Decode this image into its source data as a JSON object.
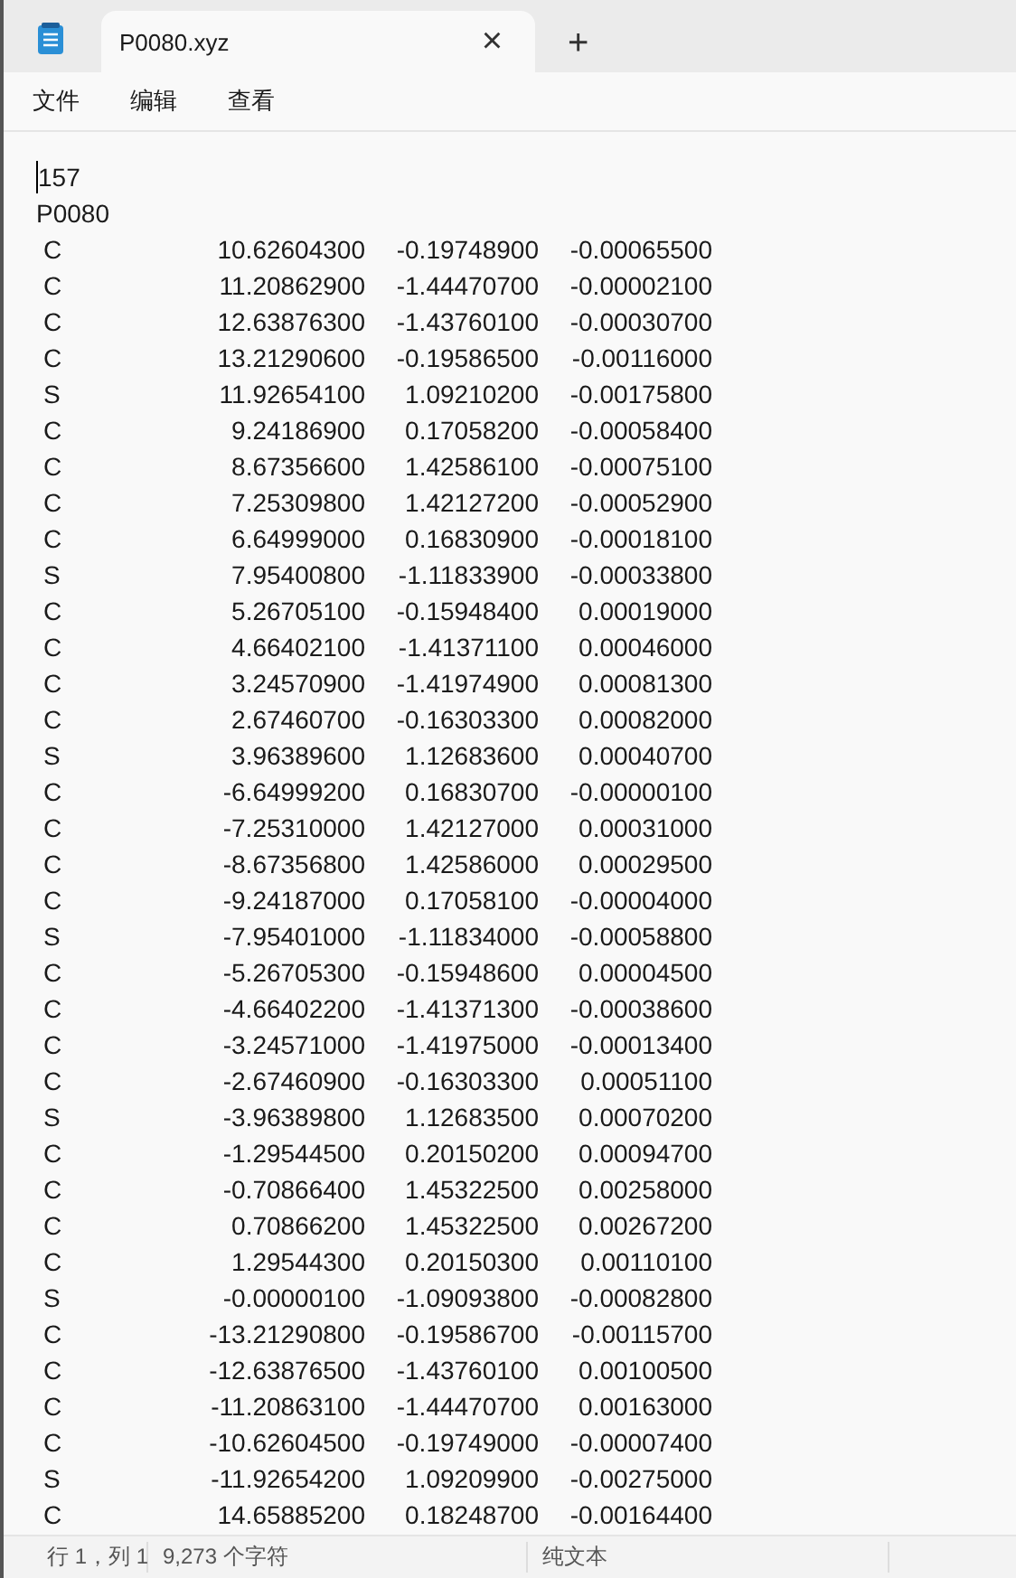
{
  "tab": {
    "title": "P0080.xyz",
    "close": "×",
    "new_tab": "+"
  },
  "menu": [
    "文件",
    "编辑",
    "查看"
  ],
  "header_lines": [
    "157",
    "P0080"
  ],
  "atoms": [
    [
      "C",
      "10.62604300",
      "-0.19748900",
      "-0.00065500"
    ],
    [
      "C",
      "11.20862900",
      "-1.44470700",
      "-0.00002100"
    ],
    [
      "C",
      "12.63876300",
      "-1.43760100",
      "-0.00030700"
    ],
    [
      "C",
      "13.21290600",
      "-0.19586500",
      "-0.00116000"
    ],
    [
      "S",
      "11.92654100",
      "1.09210200",
      "-0.00175800"
    ],
    [
      "C",
      "9.24186900",
      "0.17058200",
      "-0.00058400"
    ],
    [
      "C",
      "8.67356600",
      "1.42586100",
      "-0.00075100"
    ],
    [
      "C",
      "7.25309800",
      "1.42127200",
      "-0.00052900"
    ],
    [
      "C",
      "6.64999000",
      "0.16830900",
      "-0.00018100"
    ],
    [
      "S",
      "7.95400800",
      "-1.11833900",
      "-0.00033800"
    ],
    [
      "C",
      "5.26705100",
      "-0.15948400",
      "0.00019000"
    ],
    [
      "C",
      "4.66402100",
      "-1.41371100",
      "0.00046000"
    ],
    [
      "C",
      "3.24570900",
      "-1.41974900",
      "0.00081300"
    ],
    [
      "C",
      "2.67460700",
      "-0.16303300",
      "0.00082000"
    ],
    [
      "S",
      "3.96389600",
      "1.12683600",
      "0.00040700"
    ],
    [
      "C",
      "-6.64999200",
      "0.16830700",
      "-0.00000100"
    ],
    [
      "C",
      "-7.25310000",
      "1.42127000",
      "0.00031000"
    ],
    [
      "C",
      "-8.67356800",
      "1.42586000",
      "0.00029500"
    ],
    [
      "C",
      "-9.24187000",
      "0.17058100",
      "-0.00004000"
    ],
    [
      "S",
      "-7.95401000",
      "-1.11834000",
      "-0.00058800"
    ],
    [
      "C",
      "-5.26705300",
      "-0.15948600",
      "0.00004500"
    ],
    [
      "C",
      "-4.66402200",
      "-1.41371300",
      "-0.00038600"
    ],
    [
      "C",
      "-3.24571000",
      "-1.41975000",
      "-0.00013400"
    ],
    [
      "C",
      "-2.67460900",
      "-0.16303300",
      "0.00051100"
    ],
    [
      "S",
      "-3.96389800",
      "1.12683500",
      "0.00070200"
    ],
    [
      "C",
      "-1.29544500",
      "0.20150200",
      "0.00094700"
    ],
    [
      "C",
      "-0.70866400",
      "1.45322500",
      "0.00258000"
    ],
    [
      "C",
      "0.70866200",
      "1.45322500",
      "0.00267200"
    ],
    [
      "C",
      "1.29544300",
      "0.20150300",
      "0.00110100"
    ],
    [
      "S",
      "-0.00000100",
      "-1.09093800",
      "-0.00082800"
    ],
    [
      "C",
      "-13.21290800",
      "-0.19586700",
      "-0.00115700"
    ],
    [
      "C",
      "-12.63876500",
      "-1.43760100",
      "0.00100500"
    ],
    [
      "C",
      "-11.20863100",
      "-1.44470700",
      "0.00163000"
    ],
    [
      "C",
      "-10.62604500",
      "-0.19749000",
      "-0.00007400"
    ],
    [
      "S",
      "-11.92654200",
      "1.09209900",
      "-0.00275000"
    ],
    [
      "C",
      "14.65885200",
      "0.18248700",
      "-0.00164400"
    ]
  ],
  "status_bar": [
    "行 1，列 1",
    "9,273 个字符",
    "纯文本"
  ]
}
